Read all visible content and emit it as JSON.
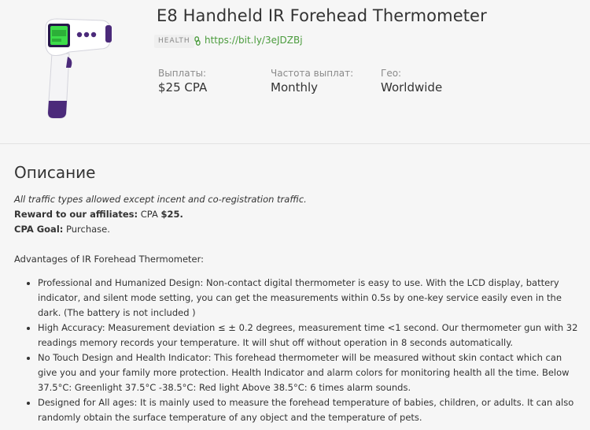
{
  "offer": {
    "title": "E8 Handheld IR Forehead Thermometer",
    "tag": "HEALTH",
    "link": "https://bit.ly/3eJDZBj",
    "image_icon": "thermometer-gun-image"
  },
  "stats": {
    "payout_label": "Выплаты:",
    "payout_value": "$25 CPA",
    "frequency_label": "Частота выплат:",
    "frequency_value": "Monthly",
    "geo_label": "Гео:",
    "geo_value": "Worldwide"
  },
  "description": {
    "heading": "Описание",
    "traffic_note": "All traffic types allowed except incent and co-registration traffic.",
    "reward_label": "Reward to our affiliates:",
    "reward_prefix": "CPA",
    "reward_value": "$25.",
    "goal_label": "CPA Goal:",
    "goal_value": "Purchase.",
    "advantages_title": "Advantages of IR Forehead Thermometer:",
    "advantages": [
      "Professional and Humanized Design: Non-contact digital thermometer is easy to use. With the LCD display, battery indicator, and silent mode setting, you can get the measurements within 0.5s by one-key service easily even in the dark. (The battery is not included )",
      "High Accuracy:  Measurement deviation ≤ ± 0.2 degrees, measurement time <1 second. Our thermometer gun with 32 readings memory records your temperature. It will shut off without operation in 8 seconds automatically.",
      "No Touch Design and Health Indicator: This forehead thermometer will be measured without skin contact which can give you and your family more protection. Health Indicator and alarm colors for monitoring health all the time. Below 37.5°C: Greenlight 37.5°C -38.5°C: Red light Above 38.5°C: 6 times alarm sounds.",
      "Designed for All ages: It is mainly used to measure the forehead temperature of babies, children, or adults. It can also randomly obtain the surface temperature of any object and the temperature of pets."
    ]
  },
  "colors": {
    "link": "#4a9b3c",
    "body_text": "#333333",
    "muted_text": "#8a8a8a",
    "background": "#f6f6f6",
    "device_purple": "#4b2a7a",
    "screen_green": "#3ddc4a"
  }
}
